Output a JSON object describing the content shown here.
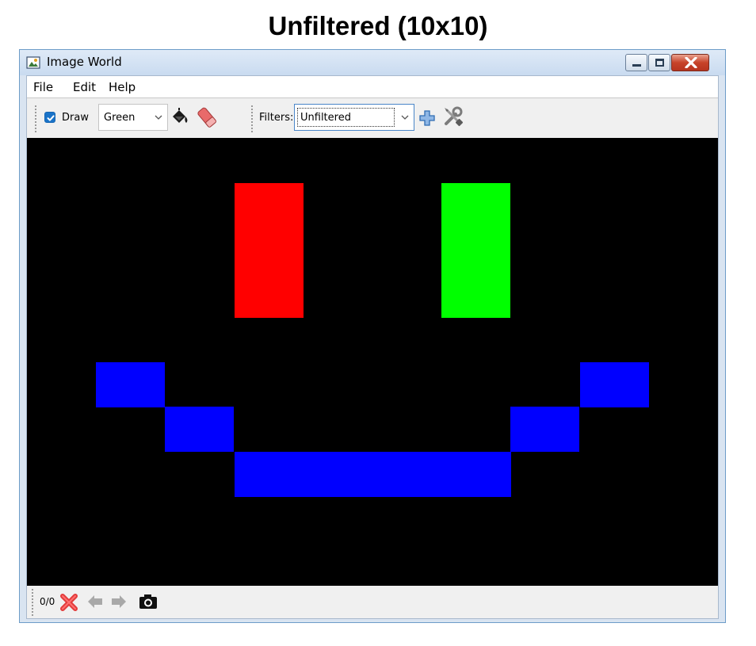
{
  "heading": "Unfiltered (10x10)",
  "window": {
    "title": "Image World",
    "icon": "image-icon"
  },
  "menu": [
    "File",
    "Edit",
    "Help"
  ],
  "toolbar": {
    "draw_checked": true,
    "draw_label": "Draw",
    "color_value": "Green",
    "fill_icon": "paint-bucket-icon",
    "eraser_icon": "eraser-icon",
    "filters_label": "Filters:",
    "filter_value": "Unfiltered",
    "add_filter_icon": "plus-icon",
    "settings_icon": "tools-icon"
  },
  "canvas": {
    "grid_size": "10x10",
    "background": "#000000",
    "cells": [
      {
        "row": 1,
        "col": 3,
        "row_span": 3,
        "col_span": 1,
        "color": "#ff0000"
      },
      {
        "row": 1,
        "col": 6,
        "row_span": 3,
        "col_span": 1,
        "color": "#00ff00"
      },
      {
        "row": 5,
        "col": 1,
        "row_span": 1,
        "col_span": 1,
        "color": "#0000ff"
      },
      {
        "row": 5,
        "col": 8,
        "row_span": 1,
        "col_span": 1,
        "color": "#0000ff"
      },
      {
        "row": 6,
        "col": 2,
        "row_span": 1,
        "col_span": 1,
        "color": "#0000ff"
      },
      {
        "row": 6,
        "col": 7,
        "row_span": 1,
        "col_span": 1,
        "color": "#0000ff"
      },
      {
        "row": 7,
        "col": 3,
        "row_span": 1,
        "col_span": 4,
        "color": "#0000ff"
      }
    ]
  },
  "status": {
    "counter": "0/0",
    "clear_icon": "red-x-icon",
    "back_icon": "arrow-left-icon",
    "forward_icon": "arrow-right-icon",
    "snapshot_icon": "camera-icon"
  }
}
